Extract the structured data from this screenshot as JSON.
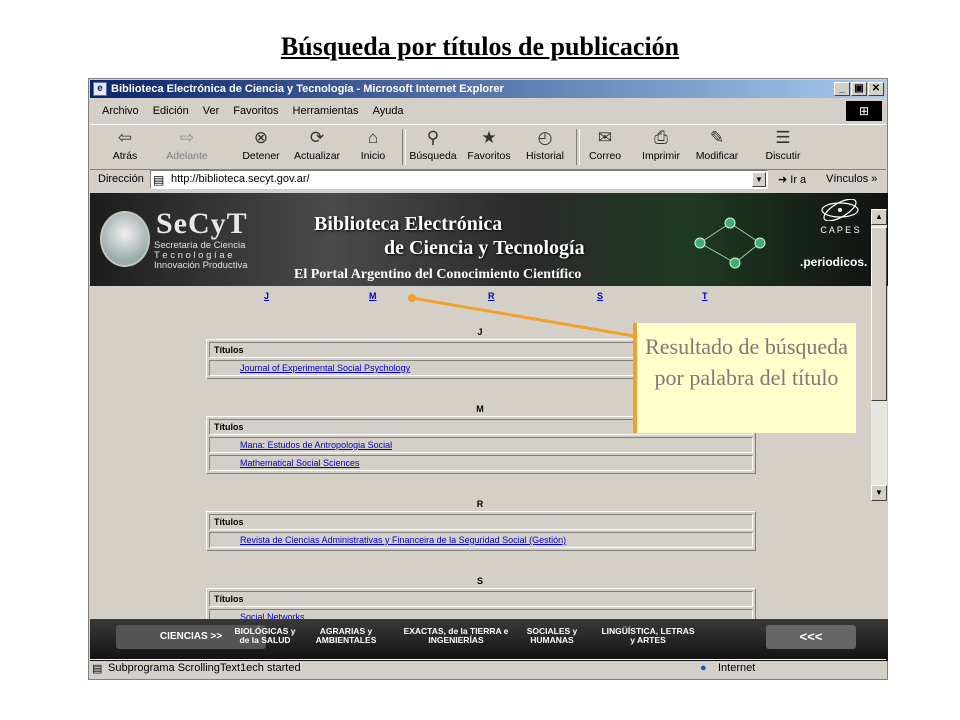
{
  "slide": {
    "title": "Búsqueda por títulos de publicación"
  },
  "window": {
    "title": "Biblioteca Electrónica de Ciencia y Tecnología - Microsoft Internet Explorer",
    "minimize": "_",
    "maximize": "▣",
    "close": "✕"
  },
  "menu": [
    "Archivo",
    "Edición",
    "Ver",
    "Favoritos",
    "Herramientas",
    "Ayuda"
  ],
  "toolbar": {
    "back": "Atrás",
    "forward": "Adelante",
    "stop": "Detener",
    "refresh": "Actualizar",
    "home": "Inicio",
    "search": "Búsqueda",
    "favorites": "Favoritos",
    "history": "Historial",
    "mail": "Correo",
    "print": "Imprimir",
    "edit": "Modificar",
    "discuss": "Discutir"
  },
  "address": {
    "label": "Dirección",
    "url": "http://biblioteca.secyt.gov.ar/",
    "go": "Ir a",
    "links": "Vínculos"
  },
  "banner": {
    "logo": "SeCyT",
    "subtitle": [
      "Secretaría de Ciencia",
      "T e c n o l o g í a   e",
      "Innovación Productiva"
    ],
    "line1": "Biblioteca Electrónica",
    "line2": "de Ciencia y Tecnología",
    "portal": "El Portal Argentino del Conocimiento Científico",
    "capes": "C A P E S",
    "periodicos": ".periodicos."
  },
  "letters": [
    "J",
    "M",
    "R",
    "S",
    "T"
  ],
  "sections": [
    {
      "letter": "J",
      "header": "Títulos",
      "rows": [
        "Journal of Experimental Social Psychology"
      ]
    },
    {
      "letter": "M",
      "header": "Títulos",
      "rows": [
        "Mana: Estudos de Antropologia Social",
        "Mathematical Social Sciences"
      ]
    },
    {
      "letter": "R",
      "header": "Títulos",
      "rows": [
        "Revista de Ciencias Administrativas y Financeira de la Seguridad Social (Gestión)"
      ]
    },
    {
      "letter": "S",
      "header": "Títulos",
      "rows": [
        "Social Networks"
      ]
    }
  ],
  "nav": {
    "ciencias": "CIENCIAS >>",
    "items": [
      "BIOLÓGICAS y de la SALUD",
      "AGRARIAS y AMBIENTALES",
      "EXACTAS, de la TIERRA e INGENIERÍAS",
      "SOCIALES y HUMANAS",
      "LINGÜÍSTICA, LETRAS y ARTES"
    ],
    "back": "<<<"
  },
  "status": {
    "message": "Subprograma ScrollingText1ech started",
    "zone": "Internet"
  },
  "callout": {
    "text": "Resultado de búsqueda por palabra del título"
  },
  "colors": {
    "callout_border": "#f0a030",
    "callout_bg": "#ffffcc",
    "link": "#0000cc"
  }
}
